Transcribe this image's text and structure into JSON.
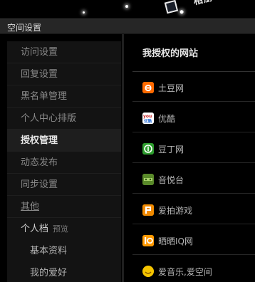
{
  "banner": {
    "badge_label": "相册",
    "badge_icon": "album-box-icon"
  },
  "header": {
    "title": "空间设置"
  },
  "sidebar": {
    "items": [
      {
        "label": "访问设置",
        "active": false
      },
      {
        "label": "回复设置",
        "active": false
      },
      {
        "label": "黑名单管理",
        "active": false
      },
      {
        "label": "个人中心排版",
        "active": false
      },
      {
        "label": "授权管理",
        "active": true
      },
      {
        "label": "动态发布",
        "active": false
      },
      {
        "label": "同步设置",
        "active": false
      },
      {
        "label": "其他",
        "active": false,
        "underlined": true
      }
    ],
    "group": {
      "label": "个人档",
      "extra": "预览",
      "subitems": [
        {
          "label": "基本资料"
        },
        {
          "label": "我的爱好"
        }
      ]
    }
  },
  "main": {
    "title": "我授权的网站",
    "sites": [
      {
        "name": "土豆网",
        "icon": "tudou-icon",
        "color": "#ff6a00"
      },
      {
        "name": "优酷",
        "icon": "youku-icon",
        "color": "#ffffff"
      },
      {
        "name": "豆丁网",
        "icon": "docin-icon",
        "color": "#2e9e2e"
      },
      {
        "name": "音悦台",
        "icon": "yinyuetai-icon",
        "color": "#5a8a2a"
      },
      {
        "name": "爱拍游戏",
        "icon": "aipai-icon",
        "color": "#f08a00"
      },
      {
        "name": "晒晒IQ网",
        "icon": "shaishaiiq-icon",
        "color": "#ff9900"
      },
      {
        "name": "爱音乐,爱空间",
        "icon": "imusic-icon",
        "color": "#f5c400"
      }
    ]
  },
  "colors": {
    "background": "#000000",
    "sidebar_bg": "#131313",
    "active_bg": "#1e1e1e",
    "header_bg": "#262626"
  }
}
